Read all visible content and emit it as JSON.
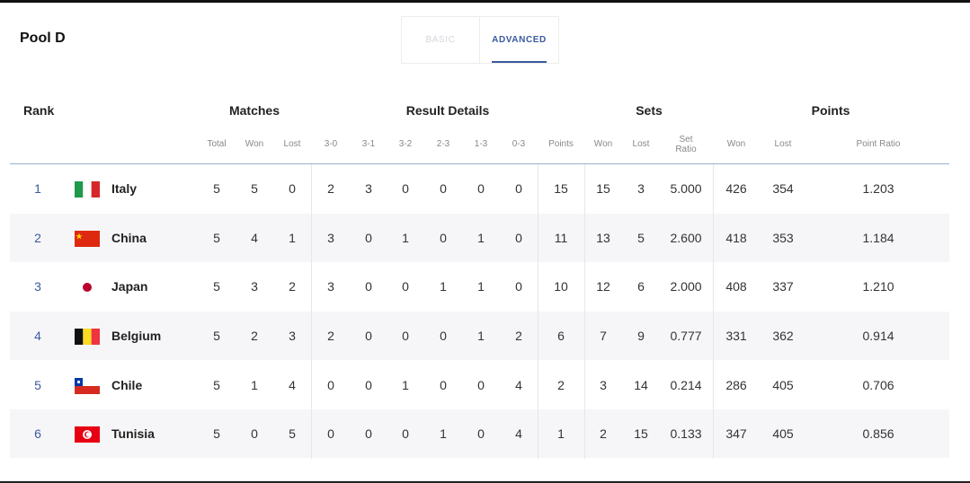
{
  "pool_title": "Pool D",
  "tabs": [
    {
      "label": "BASIC",
      "active": false
    },
    {
      "label": "ADVANCED",
      "active": true
    }
  ],
  "columns": {
    "rank": "Rank",
    "groups": {
      "matches": "Matches",
      "result_details": "Result Details",
      "sets": "Sets",
      "points": "Points"
    },
    "sub": [
      "Total",
      "Won",
      "Lost",
      "3-0",
      "3-1",
      "3-2",
      "2-3",
      "1-3",
      "0-3",
      "Points",
      "Won",
      "Lost",
      "Set Ratio",
      "Won",
      "Lost",
      "Point Ratio"
    ]
  },
  "colors": {
    "accent": "#3a5a9e",
    "row_alt": "#f6f6f8"
  },
  "rows": [
    {
      "rank": "1",
      "country": "Italy",
      "flag": "italy-flag-icon",
      "values": [
        "5",
        "5",
        "0",
        "2",
        "3",
        "0",
        "0",
        "0",
        "0",
        "15",
        "15",
        "3",
        "5.000",
        "426",
        "354",
        "1.203"
      ]
    },
    {
      "rank": "2",
      "country": "China",
      "flag": "china-flag-icon",
      "values": [
        "5",
        "4",
        "1",
        "3",
        "0",
        "1",
        "0",
        "1",
        "0",
        "11",
        "13",
        "5",
        "2.600",
        "418",
        "353",
        "1.184"
      ]
    },
    {
      "rank": "3",
      "country": "Japan",
      "flag": "japan-flag-icon",
      "values": [
        "5",
        "3",
        "2",
        "3",
        "0",
        "0",
        "1",
        "1",
        "0",
        "10",
        "12",
        "6",
        "2.000",
        "408",
        "337",
        "1.210"
      ]
    },
    {
      "rank": "4",
      "country": "Belgium",
      "flag": "belgium-flag-icon",
      "values": [
        "5",
        "2",
        "3",
        "2",
        "0",
        "0",
        "0",
        "1",
        "2",
        "6",
        "7",
        "9",
        "0.777",
        "331",
        "362",
        "0.914"
      ]
    },
    {
      "rank": "5",
      "country": "Chile",
      "flag": "chile-flag-icon",
      "values": [
        "5",
        "1",
        "4",
        "0",
        "0",
        "1",
        "0",
        "0",
        "4",
        "2",
        "3",
        "14",
        "0.214",
        "286",
        "405",
        "0.706"
      ]
    },
    {
      "rank": "6",
      "country": "Tunisia",
      "flag": "tunisia-flag-icon",
      "values": [
        "5",
        "0",
        "5",
        "0",
        "0",
        "0",
        "1",
        "0",
        "4",
        "1",
        "2",
        "15",
        "0.133",
        "347",
        "405",
        "0.856"
      ]
    }
  ]
}
